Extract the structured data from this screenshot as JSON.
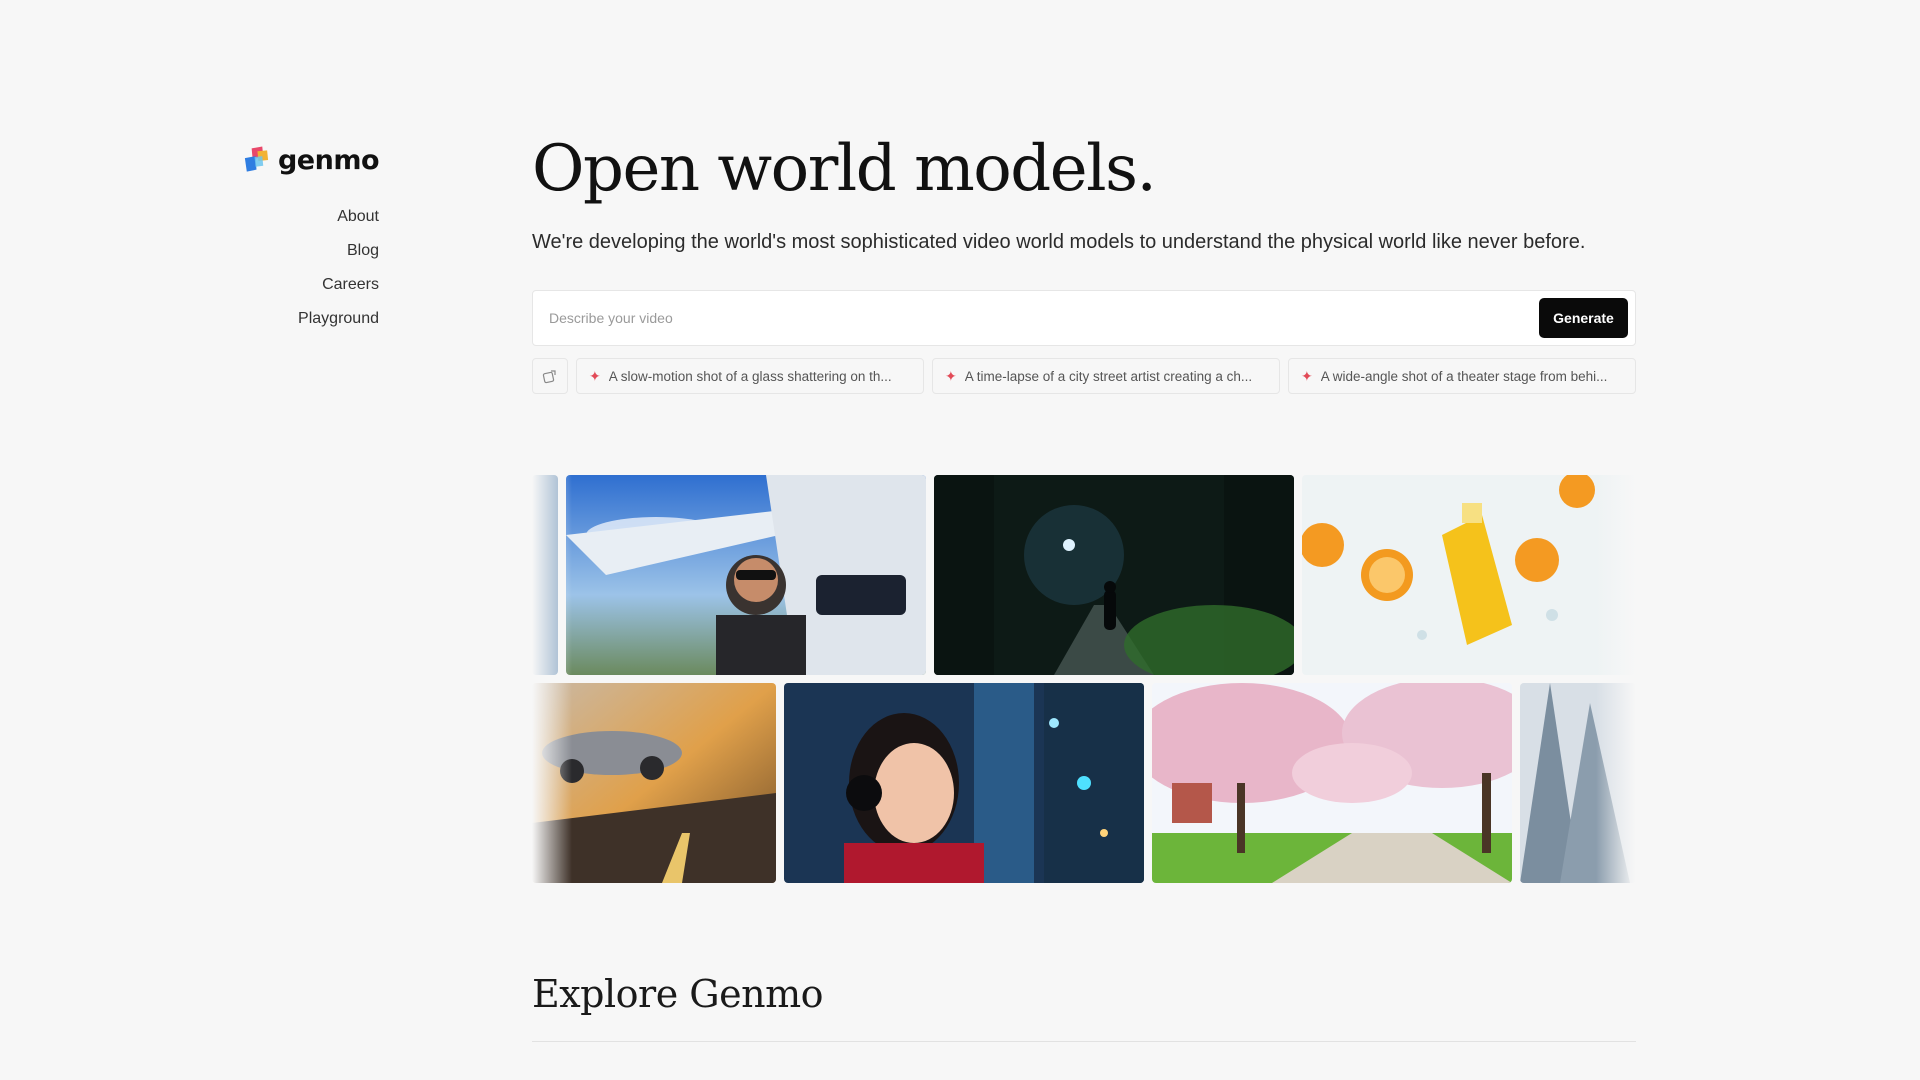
{
  "brand": {
    "name": "genmo",
    "logo_colors": [
      "#f2b233",
      "#e9486a",
      "#2f7de1",
      "#6cc6ef"
    ]
  },
  "nav": {
    "items": [
      {
        "label": "About"
      },
      {
        "label": "Blog"
      },
      {
        "label": "Careers"
      },
      {
        "label": "Playground"
      }
    ]
  },
  "hero": {
    "title": "Open world models.",
    "subtitle": "We're developing the world's most sophisticated video world models to understand the physical world like never before."
  },
  "prompt": {
    "placeholder": "Describe your video",
    "value": "",
    "generate_label": "Generate",
    "shuffle_icon": "shuffle-icon"
  },
  "suggestions": [
    {
      "icon": "sparkle-icon",
      "text": "A slow-motion shot of a glass shattering on th..."
    },
    {
      "icon": "sparkle-icon",
      "text": "A time-lapse of a city street artist creating a ch..."
    },
    {
      "icon": "sparkle-icon",
      "text": "A wide-angle shot of a theater stage from behi..."
    }
  ],
  "gallery": {
    "row1": [
      "airplane-pilot-video",
      "night-forest-path-video",
      "orange-juice-splash-video"
    ],
    "row2": [
      "sports-car-desert-video",
      "girl-headphones-video",
      "cherry-blossom-park-video",
      "snowy-pine-video"
    ]
  },
  "explore": {
    "title": "Explore Genmo"
  },
  "colors": {
    "background": "#f7f7f7",
    "button": "#0a0a0a",
    "accent": "#e24a57"
  }
}
